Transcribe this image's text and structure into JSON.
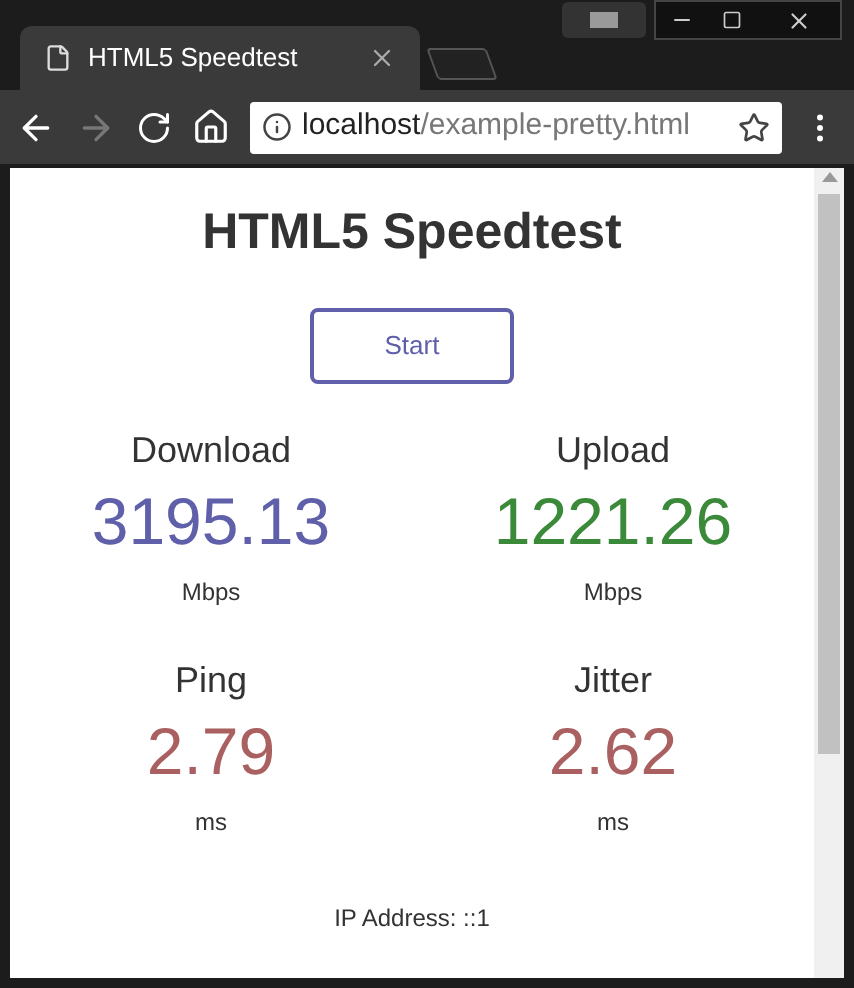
{
  "browser": {
    "tab": {
      "title": "HTML5 Speedtest"
    },
    "forward_disabled": true,
    "address": {
      "host": "localhost",
      "path": "/example-pretty.html"
    }
  },
  "page": {
    "title": "HTML5 Speedtest",
    "start_button": "Start",
    "metrics": [
      {
        "label": "Download",
        "value": "3195.13",
        "unit": "Mbps",
        "color": "#6060aa"
      },
      {
        "label": "Upload",
        "value": "1221.26",
        "unit": "Mbps",
        "color": "#3a8a3a"
      },
      {
        "label": "Ping",
        "value": "2.79",
        "unit": "ms",
        "color": "#aa6060"
      },
      {
        "label": "Jitter",
        "value": "2.62",
        "unit": "ms",
        "color": "#aa6060"
      }
    ],
    "ip": "IP Address: ::1"
  }
}
